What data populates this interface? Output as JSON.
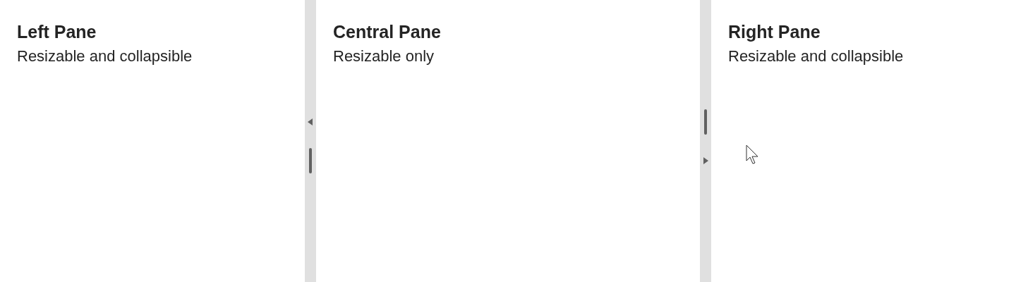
{
  "panes": [
    {
      "title": "Left Pane",
      "subtitle": "Resizable and collapsible"
    },
    {
      "title": "Central Pane",
      "subtitle": "Resizable only"
    },
    {
      "title": "Right Pane",
      "subtitle": "Resizable and collapsible"
    }
  ],
  "splitters": [
    {
      "items": [
        {
          "kind": "arrow-left"
        },
        {
          "kind": "handle"
        }
      ]
    },
    {
      "items": [
        {
          "kind": "handle"
        },
        {
          "kind": "arrow-right"
        }
      ]
    }
  ]
}
